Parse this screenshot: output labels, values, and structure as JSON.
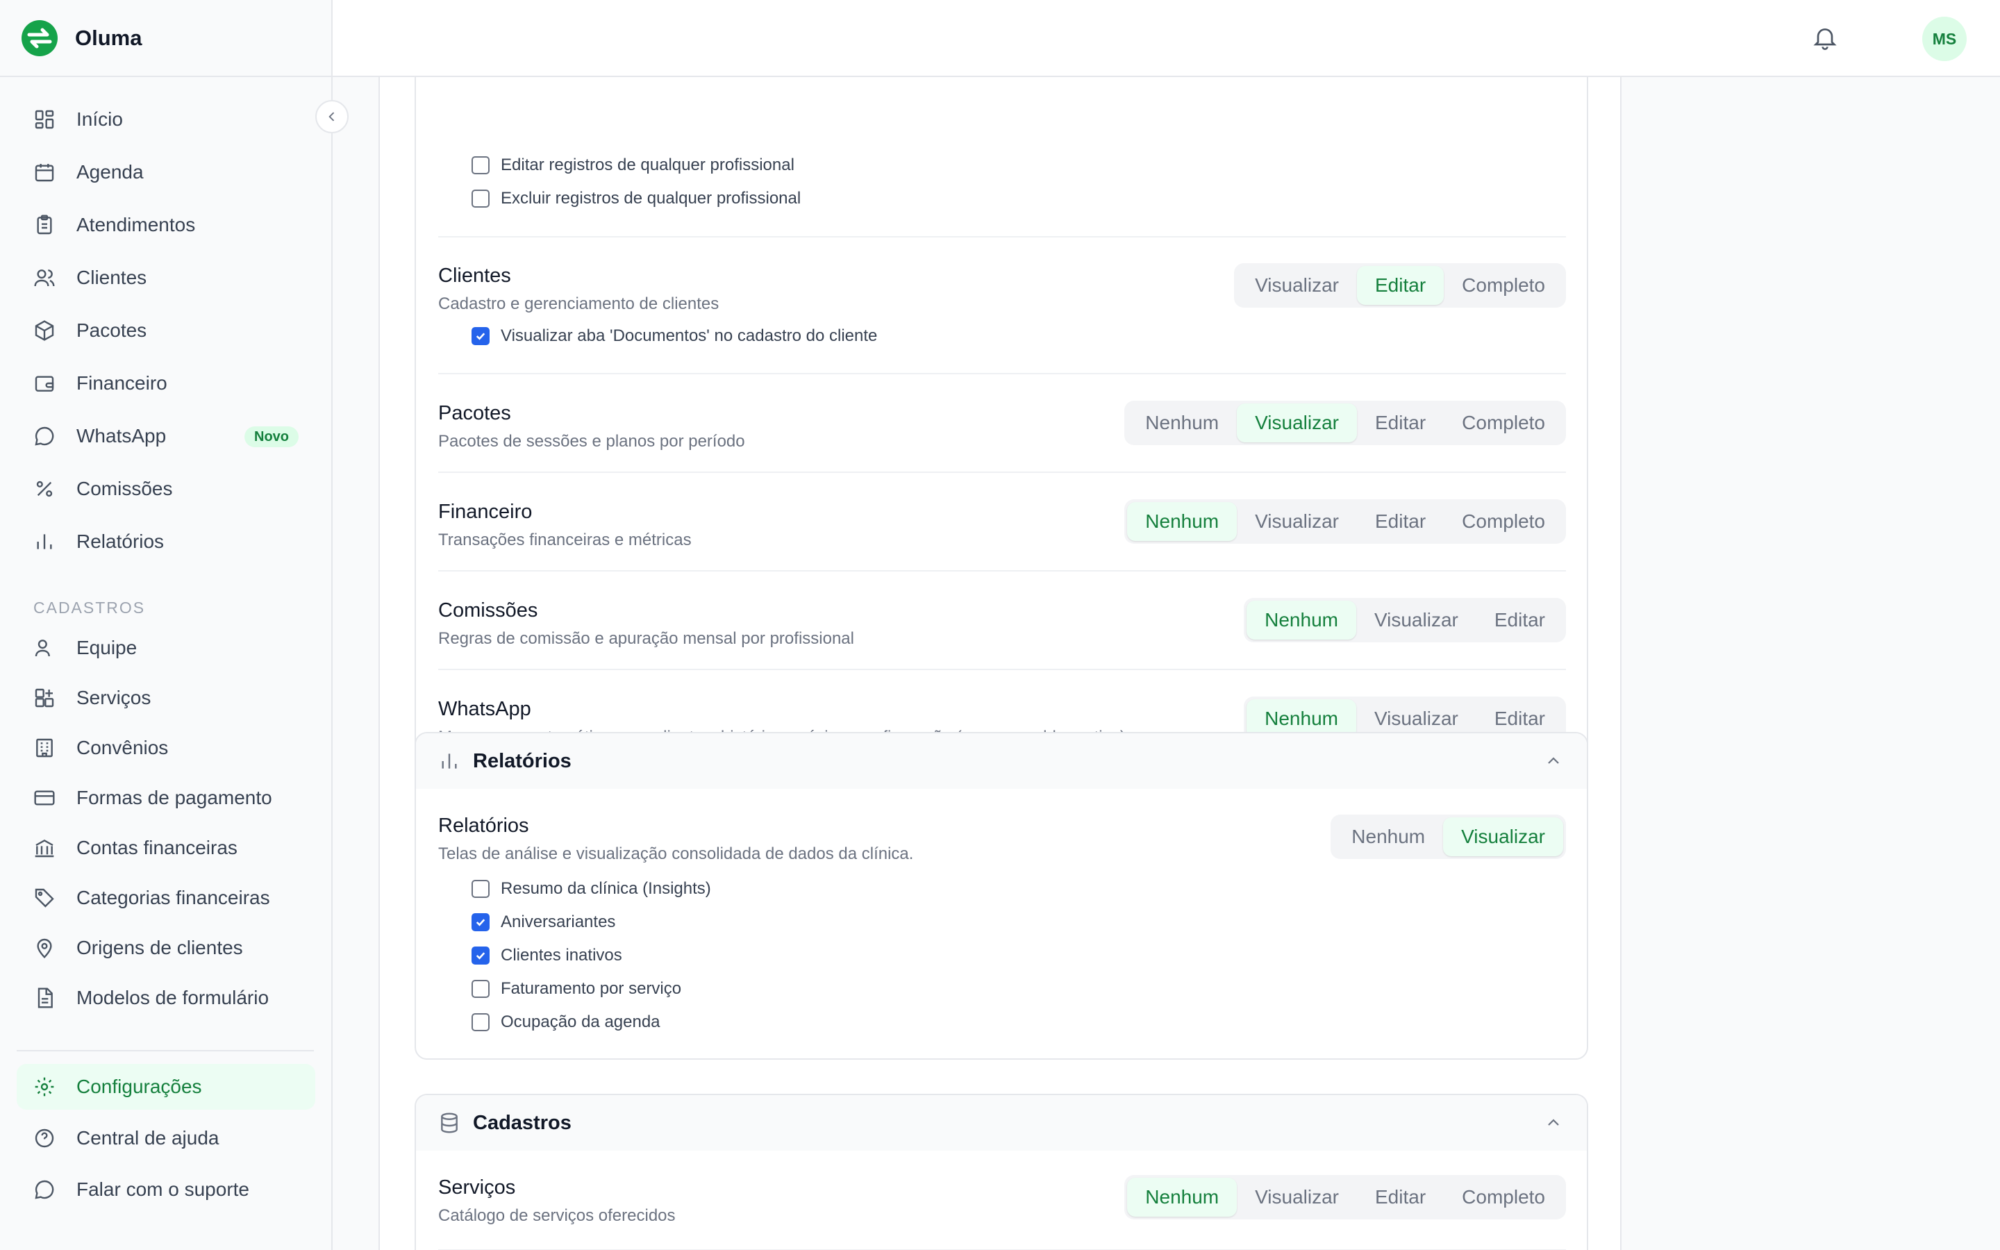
{
  "app": {
    "name": "Oluma"
  },
  "sidebar": {
    "main": [
      {
        "label": "Início",
        "icon": "dashboard-icon"
      },
      {
        "label": "Agenda",
        "icon": "calendar-icon"
      },
      {
        "label": "Atendimentos",
        "icon": "clipboard-icon"
      },
      {
        "label": "Clientes",
        "icon": "users-icon"
      },
      {
        "label": "Pacotes",
        "icon": "package-icon"
      },
      {
        "label": "Financeiro",
        "icon": "wallet-icon"
      },
      {
        "label": "WhatsApp",
        "icon": "chat-icon",
        "badge": "Novo"
      },
      {
        "label": "Comissões",
        "icon": "percent-icon"
      },
      {
        "label": "Relatórios",
        "icon": "bar-chart-icon"
      }
    ],
    "section_label": "CADASTROS",
    "cadastros": [
      {
        "label": "Equipe",
        "icon": "user-icon"
      },
      {
        "label": "Serviços",
        "icon": "grid-plus-icon"
      },
      {
        "label": "Convênios",
        "icon": "building-icon"
      },
      {
        "label": "Formas de pagamento",
        "icon": "credit-card-icon"
      },
      {
        "label": "Contas financeiras",
        "icon": "bank-icon"
      },
      {
        "label": "Categorias financeiras",
        "icon": "tag-icon"
      },
      {
        "label": "Origens de clientes",
        "icon": "map-pin-icon"
      },
      {
        "label": "Modelos de formulário",
        "icon": "file-text-icon"
      }
    ],
    "bottom": [
      {
        "label": "Configurações",
        "icon": "gear-icon",
        "active": true
      },
      {
        "label": "Central de ajuda",
        "icon": "help-circle-icon"
      },
      {
        "label": "Falar com o suporte",
        "icon": "chat-icon"
      }
    ]
  },
  "header": {
    "avatar_initials": "MS"
  },
  "permissions_card": {
    "top_checks": [
      {
        "label": "Editar registros de qualquer profissional",
        "checked": false
      },
      {
        "label": "Excluir registros de qualquer profissional",
        "checked": false
      }
    ],
    "rows": [
      {
        "name": "Clientes",
        "desc": "Cadastro e gerenciamento de clientes",
        "options": [
          "Visualizar",
          "Editar",
          "Completo"
        ],
        "selected": "Editar",
        "checks": [
          {
            "label": "Visualizar aba 'Documentos' no cadastro do cliente",
            "checked": true
          }
        ]
      },
      {
        "name": "Pacotes",
        "desc": "Pacotes de sessões e planos por período",
        "options": [
          "Nenhum",
          "Visualizar",
          "Editar",
          "Completo"
        ],
        "selected": "Visualizar"
      },
      {
        "name": "Financeiro",
        "desc": "Transações financeiras e métricas",
        "options": [
          "Nenhum",
          "Visualizar",
          "Editar",
          "Completo"
        ],
        "selected": "Nenhum"
      },
      {
        "name": "Comissões",
        "desc": "Regras de comissão e apuração mensal por profissional",
        "options": [
          "Nenhum",
          "Visualizar",
          "Editar"
        ],
        "selected": "Nenhum"
      },
      {
        "name": "WhatsApp",
        "desc": "Mensagens automáticas aos clientes: histórico, prévia e configuração (requer o add-on ativo)",
        "options": [
          "Nenhum",
          "Visualizar",
          "Editar"
        ],
        "selected": "Nenhum"
      }
    ]
  },
  "reports_card": {
    "title": "Relatórios",
    "row": {
      "name": "Relatórios",
      "desc": "Telas de análise e visualização consolidada de dados da clínica.",
      "options": [
        "Nenhum",
        "Visualizar"
      ],
      "selected": "Visualizar"
    },
    "checks": [
      {
        "label": "Resumo da clínica (Insights)",
        "checked": false
      },
      {
        "label": "Aniversariantes",
        "checked": true
      },
      {
        "label": "Clientes inativos",
        "checked": true
      },
      {
        "label": "Faturamento por serviço",
        "checked": false
      },
      {
        "label": "Ocupação da agenda",
        "checked": false
      }
    ]
  },
  "cadastros_card": {
    "title": "Cadastros",
    "row": {
      "name": "Serviços",
      "desc": "Catálogo de serviços oferecidos",
      "options": [
        "Nenhum",
        "Visualizar",
        "Editar",
        "Completo"
      ],
      "selected": "Nenhum"
    }
  },
  "colors": {
    "accent": "#15803d",
    "accent_bg": "#ecfdf3",
    "checkbox": "#2563eb"
  }
}
